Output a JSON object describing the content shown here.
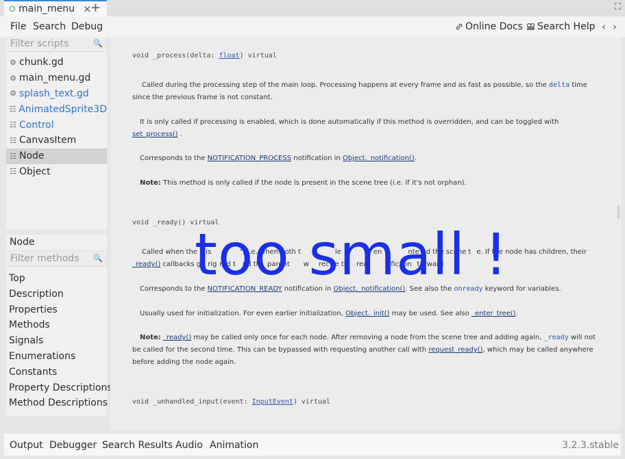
{
  "tab": {
    "title": "main_menu",
    "close": "×",
    "add": "+"
  },
  "window": {
    "expand_icon": "⛶"
  },
  "menu": {
    "file": "File",
    "search": "Search",
    "debug": "Debug"
  },
  "help_links": {
    "online_docs": "Online Docs",
    "search_help": "Search Help",
    "prev": "‹",
    "next": "›"
  },
  "scripts": {
    "filter_placeholder": "Filter scripts",
    "items": [
      {
        "label": "chunk.gd",
        "icon": "gear-icon",
        "blue": false,
        "active": false
      },
      {
        "label": "main_menu.gd",
        "icon": "gear-icon",
        "blue": false,
        "active": false
      },
      {
        "label": "splash_text.gd",
        "icon": "gear-icon",
        "blue": true,
        "active": false
      },
      {
        "label": "AnimatedSprite3D",
        "icon": "class-icon",
        "blue": true,
        "active": false
      },
      {
        "label": "Control",
        "icon": "class-icon",
        "blue": true,
        "active": false
      },
      {
        "label": "CanvasItem",
        "icon": "class-icon",
        "blue": false,
        "active": false
      },
      {
        "label": "Node",
        "icon": "class-icon",
        "blue": false,
        "active": true
      },
      {
        "label": "Object",
        "icon": "class-icon",
        "blue": false,
        "active": false
      }
    ]
  },
  "methods_panel": {
    "header": "Node",
    "filter_placeholder": "Filter methods",
    "items": [
      "Top",
      "Description",
      "Properties",
      "Methods",
      "Signals",
      "Enumerations",
      "Constants",
      "Property Descriptions",
      "Method Descriptions"
    ]
  },
  "doc": {
    "process": {
      "sig_ret": "void",
      "sig_name": "_process",
      "sig_open": "(delta: ",
      "sig_type": "float",
      "sig_close": ") virtual",
      "p1a": "Called during the processing step of the main loop. Processing happens at every frame and as fast as possible, so the ",
      "p1code": "delta",
      "p1b": " time since the previous frame is not constant.",
      "p2a": "It is only called if processing is enabled, which is done automatically if this method is overridden, and can be toggled with ",
      "p2link": "set_process()",
      "p2b": " .",
      "p3a": "Corresponds to the ",
      "p3link1": "NOTIFICATION_PROCESS",
      "p3b": " notification in ",
      "p3link2": "Object._notification()",
      "p3c": ".",
      "note_label": "Note:",
      "note_text": " This method is only called if the node is present in the scene tree (i.e. if it's not orphan)."
    },
    "ready": {
      "sig_ret": "void",
      "sig_name": "_ready",
      "sig_rest": "() virtual",
      "p1a": "Called when the ",
      "p1b": " is ",
      "p1c": "\", i.e. when both t",
      "p1d": "le",
      "p1e": "en",
      "p1f": "nte",
      "p1g": "d the scene t",
      "p1h": "e. If the node has children, their",
      "p1link": "_ready()",
      "p1i": " callbacks g",
      "p1j": "rig",
      "p1k": "red t",
      "p1l": "nd th",
      "p1m": "parent",
      "p1n": "w",
      "p1o": "rec",
      "p1p": "e th",
      "p1q": "rea",
      "p1r": "fic",
      "p1s": "on",
      "p1t": "terward",
      "p2a": "Corresponds to the ",
      "p2link1": "NOTIFICATION_READY",
      "p2b": " notification in ",
      "p2link2": "Object._notification()",
      "p2c": ". See also the ",
      "p2code": "onready",
      "p2d": " keyword for variables.",
      "p3a": "Usually used for initialization. For even earlier initialization, ",
      "p3link1": "Object._init()",
      "p3b": " may be used. See also ",
      "p3link2": "_enter_tree()",
      "p3c": ".",
      "note_label": "Note:",
      "note_link1": "_ready()",
      "note_a": " may be called only once for each node. After removing a node from the scene tree and adding again, ",
      "note_code": "_ready",
      "note_b": " will not be called for the second time. This can be bypassed with requesting another call with ",
      "note_link2": "request_ready()",
      "note_c": ", which may be called anywhere before adding the node again."
    },
    "unhandled": {
      "sig_ret": "void",
      "sig_name": "_unhandled_input",
      "sig_open": "(event: ",
      "sig_type": "InputEvent",
      "sig_close": ") virtual"
    }
  },
  "overlay_text": "too small !",
  "bottom": {
    "tabs": [
      "Output",
      "Debugger",
      "Search Results",
      "Audio",
      "Animation"
    ],
    "version": "3.2.3.stable"
  },
  "colors": {
    "accent": "#3a86d6",
    "link": "#3273c9",
    "overlay": "#1a2fe8"
  }
}
